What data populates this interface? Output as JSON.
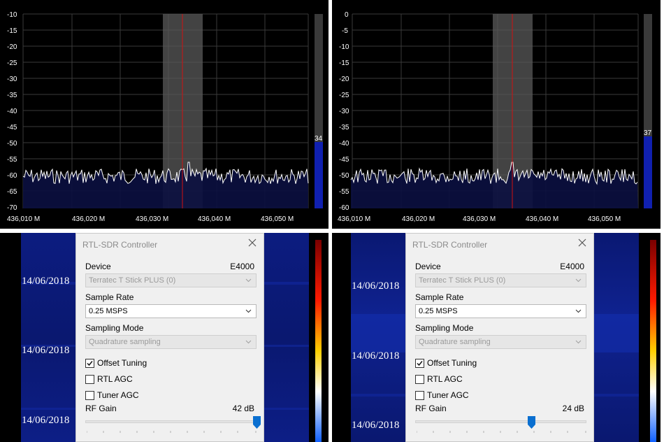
{
  "left": {
    "spectrum": {
      "y_ticks": [
        "-10",
        "-15",
        "-20",
        "-25",
        "-30",
        "-35",
        "-40",
        "-45",
        "-50",
        "-55",
        "-60",
        "-65",
        "-70"
      ],
      "x_ticks": [
        "436,010 M",
        "436,020 M",
        "436,030 M",
        "436,040 M",
        "436,050 M"
      ],
      "level_meter": "34"
    },
    "waterfall": {
      "timestamps": [
        "14/06/2018",
        "14/06/2018",
        "14/06/2018"
      ]
    },
    "dialog": {
      "title": "RTL-SDR Controller",
      "device_label": "Device",
      "device_type": "E4000",
      "device_value": "Terratec T Stick PLUS (0)",
      "sample_rate_label": "Sample Rate",
      "sample_rate_value": "0.25 MSPS",
      "sampling_mode_label": "Sampling Mode",
      "sampling_mode_value": "Quadrature sampling",
      "offset_tuning_label": "Offset Tuning",
      "offset_tuning_checked": true,
      "rtl_agc_label": "RTL AGC",
      "rtl_agc_checked": false,
      "tuner_agc_label": "Tuner AGC",
      "tuner_agc_checked": false,
      "rf_gain_label": "RF Gain",
      "rf_gain_value": "42 dB",
      "rf_gain_fraction": 1.0
    }
  },
  "right": {
    "spectrum": {
      "y_ticks": [
        "0",
        "-5",
        "-10",
        "-15",
        "-20",
        "-25",
        "-30",
        "-35",
        "-40",
        "-45",
        "-50",
        "-55",
        "-60"
      ],
      "x_ticks": [
        "436,010 M",
        "436,020 M",
        "436,030 M",
        "436,040 M",
        "436,050 M"
      ],
      "level_meter": "37"
    },
    "waterfall": {
      "timestamps": [
        "14/06/2018",
        "14/06/2018",
        "14/06/2018"
      ]
    },
    "dialog": {
      "title": "RTL-SDR Controller",
      "device_label": "Device",
      "device_type": "E4000",
      "device_value": "Terratec T Stick PLUS (0)",
      "sample_rate_label": "Sample Rate",
      "sample_rate_value": "0.25 MSPS",
      "sampling_mode_label": "Sampling Mode",
      "sampling_mode_value": "Quadrature sampling",
      "offset_tuning_label": "Offset Tuning",
      "offset_tuning_checked": true,
      "rtl_agc_label": "RTL AGC",
      "rtl_agc_checked": false,
      "tuner_agc_label": "Tuner AGC",
      "tuner_agc_checked": false,
      "rf_gain_label": "RF Gain",
      "rf_gain_value": "24 dB",
      "rf_gain_fraction": 0.68
    }
  },
  "colors": {
    "spectrum_bg": "#000000",
    "noise_fill": "#0b1040",
    "trace": "#ffffff",
    "center_line": "#d01010",
    "passband": "#5a5a5a",
    "meter_fill": "#1020b0",
    "waterfall_bg": "#0a1a78"
  }
}
